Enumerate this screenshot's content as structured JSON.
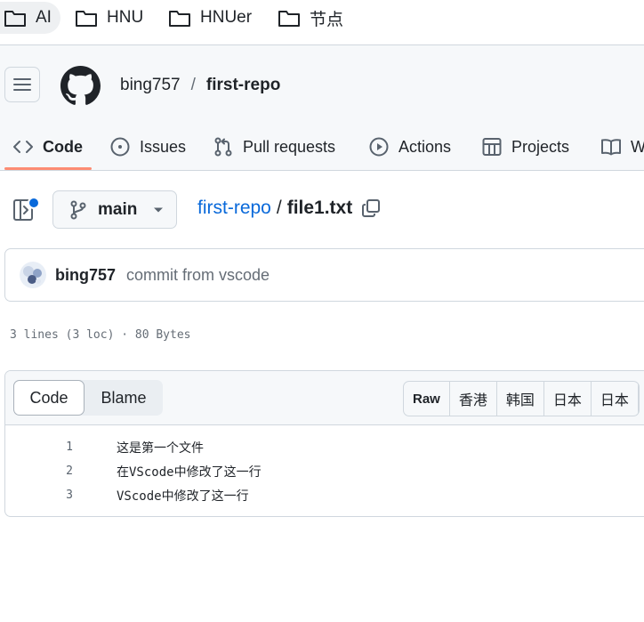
{
  "bookmarks": [
    "AI",
    "HNU",
    "HNUer",
    "节点"
  ],
  "repo": {
    "owner": "bing757",
    "separator": "/",
    "name": "first-repo"
  },
  "tabs": [
    "Code",
    "Issues",
    "Pull requests",
    "Actions",
    "Projects",
    "W"
  ],
  "branch": "main",
  "file_path": {
    "repo": "first-repo",
    "separator": "/",
    "file": "file1.txt"
  },
  "commit": {
    "author": "bing757",
    "message": "commit from vscode"
  },
  "file_meta": "3 lines (3 loc) · 80 Bytes",
  "viewer": {
    "segment": [
      "Code",
      "Blame"
    ],
    "buttons": [
      "Raw",
      "香港",
      "韩国",
      "日本",
      "日本"
    ]
  },
  "code_lines": [
    {
      "number": "1",
      "text": "这是第一个文件"
    },
    {
      "number": "2",
      "text": "在VScode中修改了这一行"
    },
    {
      "number": "3",
      "text": "VScode中修改了这一行"
    }
  ],
  "colors": {
    "accent": "#0969da",
    "tab_underline": "#fd8c73",
    "border": "#d0d7de",
    "muted": "#656d76"
  }
}
